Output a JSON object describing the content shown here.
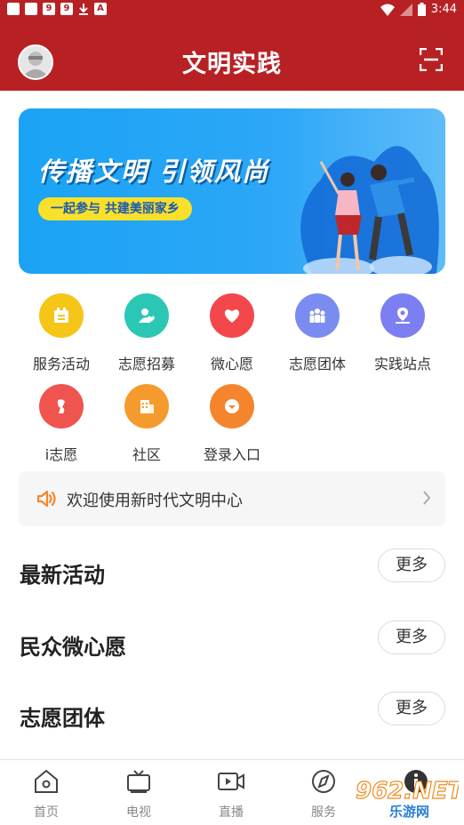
{
  "status_bar": {
    "time": "3:44",
    "left_icons": [
      "notification-square",
      "notification-square",
      "app-9",
      "app-9",
      "download-icon",
      "app-a"
    ]
  },
  "header": {
    "title": "文明实践"
  },
  "banner": {
    "headline": "传播文明 引领风尚",
    "subline": "一起参与 共建美丽家乡"
  },
  "grid": [
    {
      "label": "服务活动",
      "icon": "calendar-icon",
      "color": "#f5c518"
    },
    {
      "label": "志愿招募",
      "icon": "user-heart-icon",
      "color": "#2bc7b4"
    },
    {
      "label": "微心愿",
      "icon": "heart-icon",
      "color": "#f2484b"
    },
    {
      "label": "志愿团体",
      "icon": "group-icon",
      "color": "#7a8cf0"
    },
    {
      "label": "实践站点",
      "icon": "location-icon",
      "color": "#7b7ff2"
    },
    {
      "label": "i志愿",
      "icon": "volunteer-icon",
      "color": "#f0544f"
    },
    {
      "label": "社区",
      "icon": "building-icon",
      "color": "#f59b2d"
    },
    {
      "label": "登录入口",
      "icon": "login-icon",
      "color": "#f5852d"
    }
  ],
  "notice": {
    "text": "欢迎使用新时代文明中心"
  },
  "sections": [
    {
      "title": "最新活动",
      "more": "更多"
    },
    {
      "title": "民众微心愿",
      "more": "更多"
    },
    {
      "title": "志愿团体",
      "more": "更多"
    }
  ],
  "tabs": [
    {
      "label": "首页",
      "icon": "home-icon"
    },
    {
      "label": "电视",
      "icon": "tv-icon"
    },
    {
      "label": "直播",
      "icon": "live-video-icon"
    },
    {
      "label": "服务",
      "icon": "compass-icon"
    },
    {
      "label": "",
      "icon": "info-icon"
    }
  ],
  "watermark": {
    "text": "962.NET",
    "subtext": "乐游网"
  },
  "colors": {
    "brand_red": "#b82124",
    "banner_blue": "#1aa3f5",
    "pill_yellow": "#f9e02a"
  }
}
